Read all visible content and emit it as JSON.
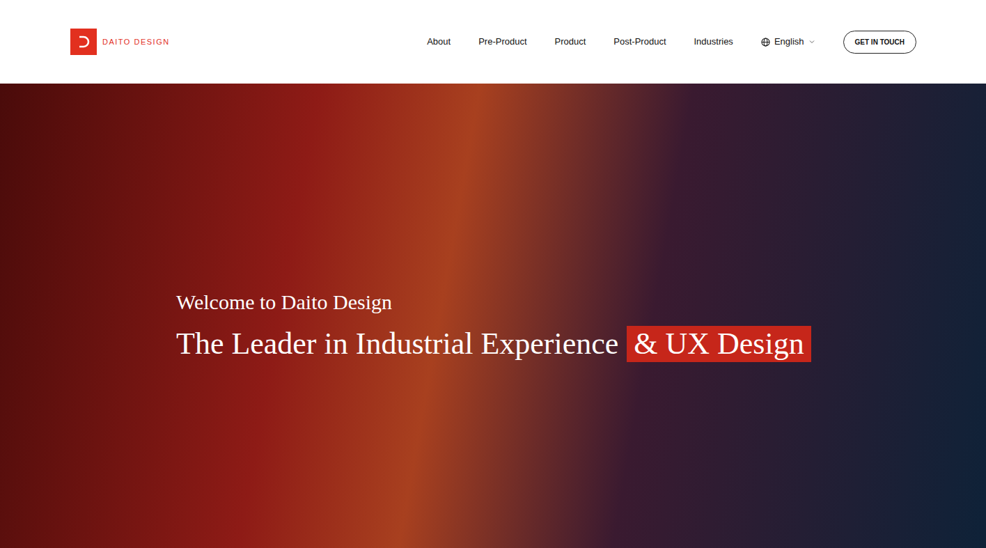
{
  "logo": {
    "text": "DAITO DESIGN"
  },
  "nav": {
    "items": [
      {
        "label": "About"
      },
      {
        "label": "Pre-Product"
      },
      {
        "label": "Product"
      },
      {
        "label": "Post-Product"
      },
      {
        "label": "Industries"
      }
    ]
  },
  "language": {
    "label": "English"
  },
  "cta": {
    "label": "GET IN TOUCH"
  },
  "hero": {
    "welcome": "Welcome to Daito Design",
    "headline": "The Leader in Industrial Experience",
    "highlight": "& UX Design"
  }
}
